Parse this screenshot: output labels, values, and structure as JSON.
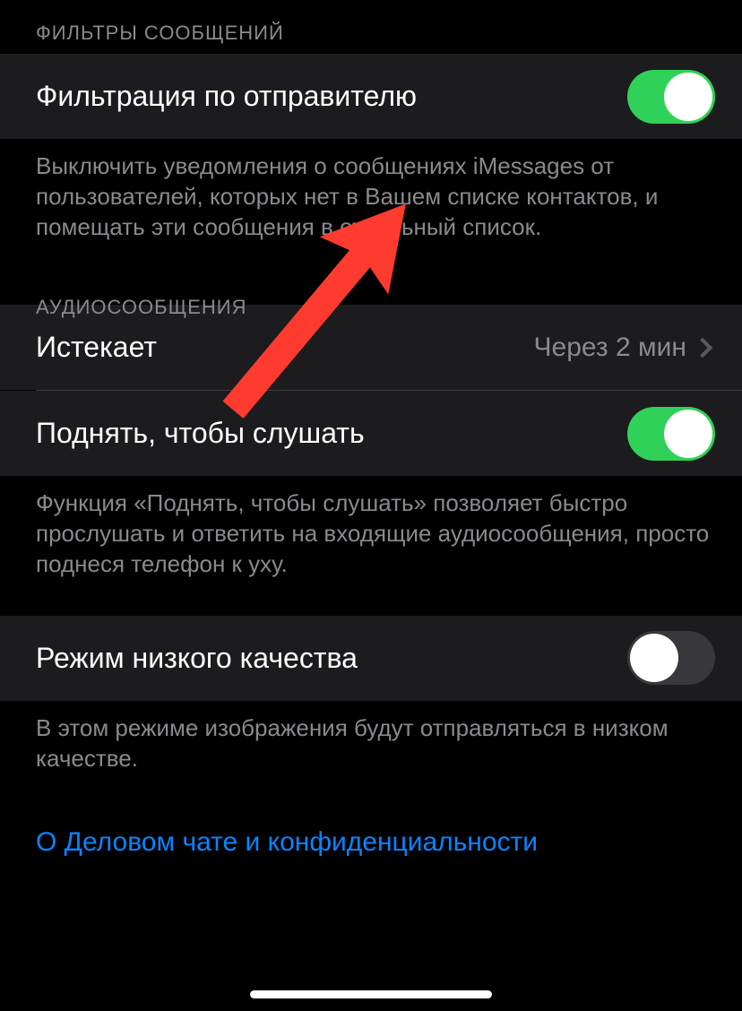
{
  "sections": {
    "filters": {
      "header": "ФИЛЬТРЫ СООБЩЕНИЙ",
      "row_label": "Фильтрация по отправителю",
      "toggle_on": true,
      "footer": "Выключить уведомления о сообщениях iMessages от пользователей, которых нет в Вашем списке контактов, и помещать эти сообщения в отдельный список."
    },
    "audio": {
      "header": "АУДИОСООБЩЕНИЯ",
      "expire_label": "Истекает",
      "expire_value": "Через 2 мин",
      "raise_label": "Поднять, чтобы слушать",
      "raise_toggle_on": true,
      "footer": "Функция «Поднять, чтобы слушать» позволяет быстро прослушать и ответить на входящие аудиосообщения, просто поднеся телефон к уху."
    },
    "lowq": {
      "row_label": "Режим низкого качества",
      "toggle_on": false,
      "footer": "В этом режиме изображения будут отправляться в низком качестве."
    },
    "link": "О Деловом чате и конфиденциальности"
  },
  "annotation": {
    "arrow_color": "#ff3b30"
  }
}
